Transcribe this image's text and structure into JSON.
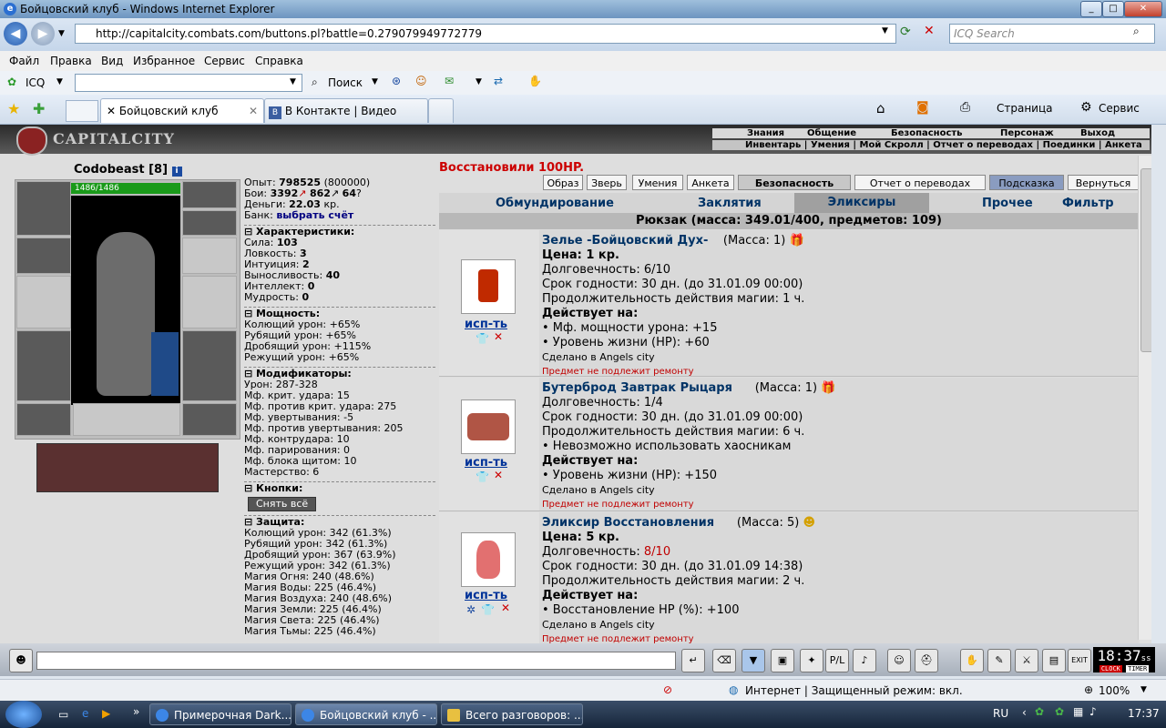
{
  "window": {
    "title": "Бойцовский клуб - Windows Internet Explorer"
  },
  "address": {
    "url": "http://capitalcity.combats.com/buttons.pl?battle=0.279079949772779",
    "search_placeholder": "ICQ Search"
  },
  "menu": [
    "Файл",
    "Правка",
    "Вид",
    "Избранное",
    "Сервис",
    "Справка"
  ],
  "toolbar": {
    "icq": "ICQ",
    "search": "Поиск"
  },
  "tabs": [
    {
      "label": "Бойцовский клуб"
    },
    {
      "label": "В Контакте | Видео"
    }
  ],
  "cmdbar": {
    "page": "Страница",
    "service": "Сервис"
  },
  "game": {
    "logo": "CAPITALCITY",
    "topnav1": [
      "Знания",
      "Общение",
      "Безопасность",
      "Персонаж",
      "Выход"
    ],
    "topnav2": "Инвентарь | Умения | Мой Скролл | Отчет о переводах | Поединки | Анкета",
    "character": {
      "name": "Codobeast",
      "level": "[8]",
      "hp": "1486/1486"
    },
    "stats": {
      "exp_label": "Опыт:",
      "exp": "798525",
      "exp_next": "(800000)",
      "fights_label": "Бои:",
      "wins": "3392",
      "losses": "862",
      "draws": "64",
      "money_label": "Деньги:",
      "money": "22.03",
      "money_unit": "кр.",
      "bank_label": "Банк:",
      "bank_link": "выбрать счёт"
    },
    "sections": {
      "characteristics": "Характеристики:",
      "power": "Мощность:",
      "modifiers": "Модификаторы:",
      "buttons": "Кнопки:",
      "protection": "Защита:"
    },
    "characteristics": [
      {
        "label": "Сила:",
        "value": "103"
      },
      {
        "label": "Ловкость:",
        "value": "3"
      },
      {
        "label": "Интуиция:",
        "value": "2"
      },
      {
        "label": "Выносливость:",
        "value": "40"
      },
      {
        "label": "Интеллект:",
        "value": "0"
      },
      {
        "label": "Мудрость:",
        "value": "0"
      }
    ],
    "power": [
      "Колющий урон: +65%",
      "Рубящий урон: +65%",
      "Дробящий урон: +115%",
      "Режущий урон: +65%"
    ],
    "modifiers": [
      "Урон: 287-328",
      "Мф. крит. удара: 15",
      "Мф. против крит. удара: 275",
      "Мф. увертывания: -5",
      "Мф. против увертывания: 205",
      "Мф. контрудара: 10",
      "Мф. парирования: 0",
      "Мф. блока щитом: 10",
      "Мастерство: 6"
    ],
    "undress_button": "Снять всё",
    "protection": [
      "Колющий урон: 342 (61.3%)",
      "Рубящий урон: 342 (61.3%)",
      "Дробящий урон: 367 (63.9%)",
      "Режущий урон: 342 (61.3%)",
      "Магия Огня: 240 (48.6%)",
      "Магия Воды: 225 (46.4%)",
      "Магия Воздуха: 240 (48.6%)",
      "Магия Земли: 225 (46.4%)",
      "Магия Света: 225 (46.4%)",
      "Магия Тьмы: 225 (46.4%)"
    ],
    "restored_msg": "Восстановили 100HP.",
    "buttons": [
      "Образ",
      "Зверь",
      "Умения",
      "Анкета",
      "Безопасность",
      "Отчет о переводах",
      "Подсказка",
      "Вернуться"
    ],
    "categories": [
      "Обмундирование",
      "Заклятия",
      "Эликсиры",
      "Прочее",
      "Фильтр"
    ],
    "backpack": "Рюкзак (масса: 349.01/400, предметов: 109)",
    "use_label": "исп-ть",
    "items": [
      {
        "name": "Зелье -Бойцовский Дух-",
        "mass": "(Масса: 1)",
        "price": "Цена: 1 кр.",
        "durability": "Долговечность: 6/10",
        "expiry": "Срок годности: 30 дн. (до 31.01.09 00:00)",
        "magic_duration": "Продолжительность действия магии: 1 ч.",
        "effects_title": "Действует на:",
        "effects": [
          "• Мф. мощности урона: +15",
          "• Уровень жизни (HP): +60"
        ],
        "made_in": "Сделано в Angels city",
        "no_repair": "Предмет не подлежит ремонту"
      },
      {
        "name": "Бутерброд Завтрак Рыцаря",
        "mass": "(Масса: 1)",
        "durability": "Долговечность: 1/4",
        "expiry": "Срок годности: 30 дн. (до 31.01.09 00:00)",
        "magic_duration": "Продолжительность действия магии: 6 ч.",
        "restriction": "• Невозможно использовать хаосникам",
        "effects_title": "Действует на:",
        "effects": [
          "• Уровень жизни (HP): +150"
        ],
        "made_in": "Сделано в Angels city",
        "no_repair": "Предмет не подлежит ремонту"
      },
      {
        "name": "Эликсир Восстановления",
        "mass": "(Масса: 5)",
        "price": "Цена: 5 кр.",
        "durability_label": "Долговечность: ",
        "durability_value": "8/10",
        "expiry": "Срок годности: 30 дн. (до 31.01.09 14:38)",
        "magic_duration": "Продолжительность действия магии: 2 ч.",
        "effects_title": "Действует на:",
        "effects": [
          "• Восстановление HP (%): +100"
        ],
        "made_in": "Сделано в Angels city",
        "no_repair": "Предмет не подлежит ремонту"
      }
    ]
  },
  "chat": {
    "clock": "18:37",
    "clock_sec": "ss",
    "clock_lbl1": "CLOCK",
    "clock_lbl2": "TIMER"
  },
  "statusbar": {
    "zone": "Интернет | Защищенный режим: вкл.",
    "zoom": "100%"
  },
  "taskbar": {
    "tasks": [
      "Примерочная Dark...",
      "Бойцовский клуб - ...",
      "Всего разговоров: ..."
    ],
    "lang": "RU",
    "time": "17:37"
  }
}
